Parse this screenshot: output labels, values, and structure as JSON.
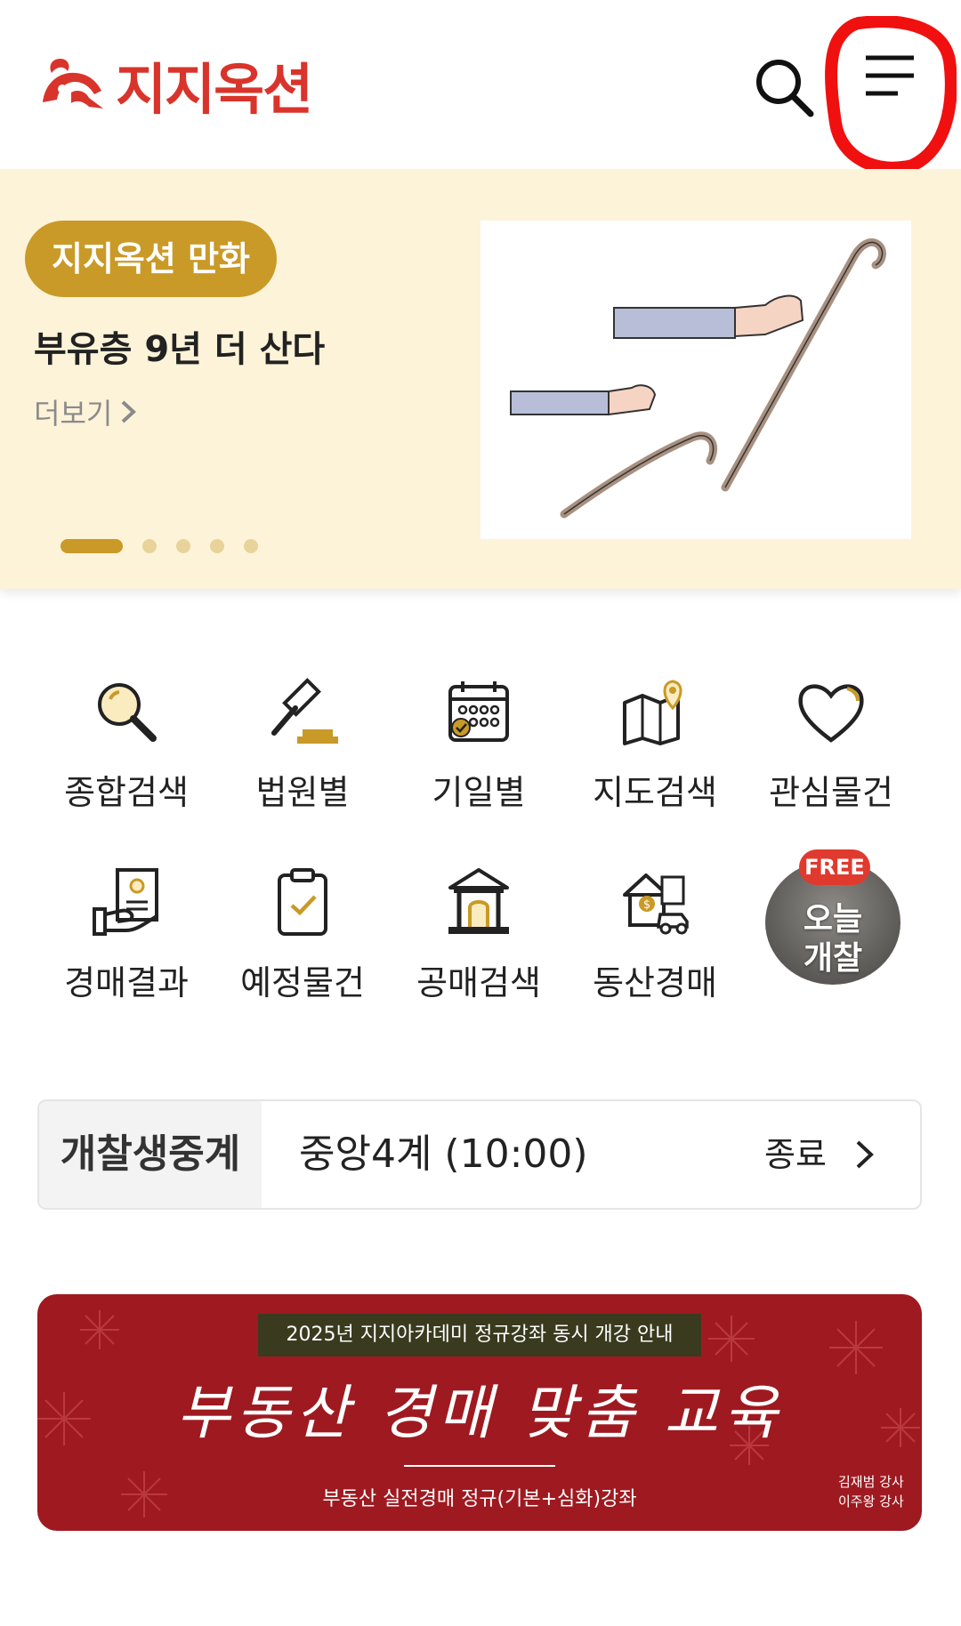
{
  "header": {
    "logo_text": "지지옥션",
    "brand_color": "#d9342b",
    "search_icon": "search-icon",
    "menu_icon": "hamburger-menu-icon"
  },
  "banner": {
    "badge": "지지옥션 만화",
    "title": "부유층 9년 더 산다",
    "more": "더보기",
    "slide_count": 5,
    "active_slide": 1,
    "accent_color": "#c99a27"
  },
  "menu": {
    "items": [
      {
        "label": "종합검색",
        "icon": "magnifier-icon"
      },
      {
        "label": "법원별",
        "icon": "gavel-icon"
      },
      {
        "label": "기일별",
        "icon": "calendar-icon"
      },
      {
        "label": "지도검색",
        "icon": "map-pin-icon"
      },
      {
        "label": "관심물건",
        "icon": "heart-icon"
      },
      {
        "label": "경매결과",
        "icon": "document-hand-icon"
      },
      {
        "label": "예정물건",
        "icon": "clipboard-check-icon"
      },
      {
        "label": "공매검색",
        "icon": "bank-building-icon"
      },
      {
        "label": "동산경매",
        "icon": "house-car-icon"
      }
    ],
    "today": {
      "badge": "FREE",
      "line1": "오늘",
      "line2": "개찰"
    }
  },
  "live": {
    "tag": "개찰생중계",
    "court": "중앙4계 (10:00)",
    "status": "종료"
  },
  "ad": {
    "top": "2025년 지지아카데미 정규강좌 동시 개강 안내",
    "main": "부동산 경매 맞춤 교육",
    "sub": "부동산 실전경매 정규(기본+심화)강좌",
    "lecturer1": "김재범 강사",
    "lecturer2": "이주왕 강사",
    "bg_color": "#9e1a20"
  }
}
